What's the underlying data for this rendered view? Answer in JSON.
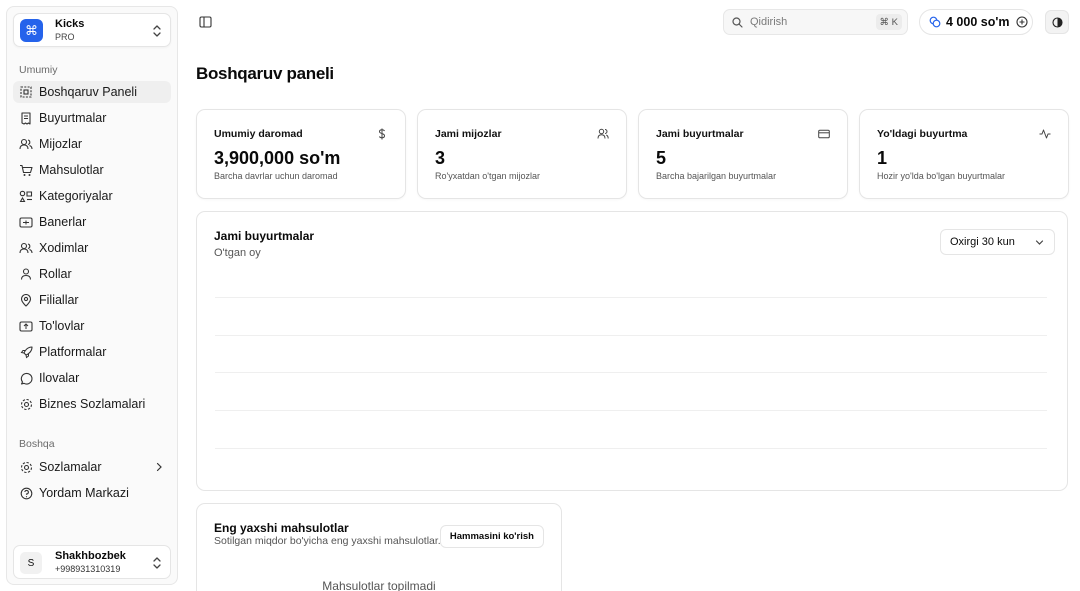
{
  "brand": {
    "name": "Kicks",
    "plan": "PRO",
    "logo_glyph": "⌘",
    "logo_color": "#2563eb"
  },
  "sidebar": {
    "section_main": "Umumiy",
    "items": [
      {
        "label": "Boshqaruv Paneli",
        "icon": "dashboard-icon",
        "active": true
      },
      {
        "label": "Buyurtmalar",
        "icon": "orders-icon"
      },
      {
        "label": "Mijozlar",
        "icon": "customers-icon"
      },
      {
        "label": "Mahsulotlar",
        "icon": "cart-icon"
      },
      {
        "label": "Kategoriyalar",
        "icon": "categories-icon"
      },
      {
        "label": "Banerlar",
        "icon": "banner-icon"
      },
      {
        "label": "Xodimlar",
        "icon": "staff-icon"
      },
      {
        "label": "Rollar",
        "icon": "role-icon"
      },
      {
        "label": "Filiallar",
        "icon": "location-icon"
      },
      {
        "label": "To'lovlar",
        "icon": "payments-icon"
      },
      {
        "label": "Platformalar",
        "icon": "rocket-icon"
      },
      {
        "label": "Ilovalar",
        "icon": "chat-icon"
      },
      {
        "label": "Biznes Sozlamalari",
        "icon": "gear-icon"
      }
    ],
    "section_other": "Boshqa",
    "other_items": [
      {
        "label": "Sozlamalar",
        "icon": "gear-icon",
        "has_chevron": true
      },
      {
        "label": "Yordam Markazi",
        "icon": "help-icon"
      }
    ]
  },
  "user": {
    "initial": "S",
    "name": "Shakhbozbek",
    "phone": "+998931310319"
  },
  "topbar": {
    "search_placeholder": "Qidirish",
    "shortcut": "⌘ K",
    "balance": "4 000 so'm"
  },
  "page": {
    "title": "Boshqaruv paneli"
  },
  "stats": [
    {
      "title": "Umumiy daromad",
      "value": "3,900,000 so'm",
      "sub": "Barcha davrlar uchun daromad",
      "icon": "dollar-icon"
    },
    {
      "title": "Jami mijozlar",
      "value": "3",
      "sub": "Ro'yxatdan o'tgan mijozlar",
      "icon": "users-icon"
    },
    {
      "title": "Jami buyurtmalar",
      "value": "5",
      "sub": "Barcha bajarilgan buyurtmalar",
      "icon": "credit-card-icon"
    },
    {
      "title": "Yo'ldagi buyurtma",
      "value": "1",
      "sub": "Hozir yo'lda bo'lgan buyurtmalar",
      "icon": "activity-icon"
    }
  ],
  "orders_chart": {
    "title": "Jami buyurtmalar",
    "subtitle": "O'tgan oy",
    "range_selected": "Oxirgi 30 kun"
  },
  "top_products": {
    "title": "Eng yaxshi mahsulotlar",
    "subtitle": "Sotilgan miqdor bo'yicha eng yaxshi mahsulotlar..",
    "button": "Hammasini ko'rish",
    "empty_text": "Mahsulotlar topilmadi"
  }
}
